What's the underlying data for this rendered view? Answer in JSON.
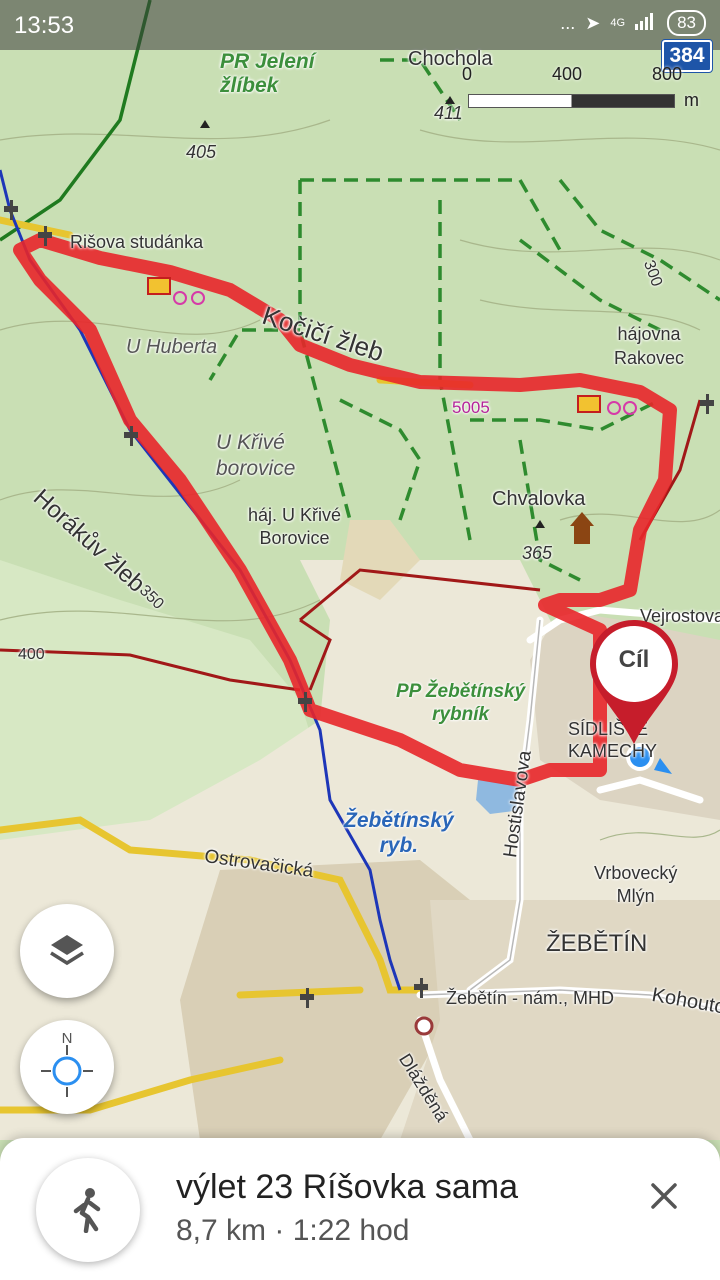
{
  "status_bar": {
    "time": "13:53",
    "dots": "...",
    "network": "4G",
    "battery": "83"
  },
  "route_number": "384",
  "scale": {
    "zero": "0",
    "mid": "400",
    "end": "800",
    "unit": "m"
  },
  "map_labels": {
    "pr_jeleni_zlibek": "PR Jelení\nžlíbek",
    "chochola": "Chochola",
    "e411": "411",
    "e405": "405",
    "risova_studanka": "Rišova studánka",
    "u_huberta": "U Huberta",
    "kocici_zleb": "Kočičí žleb",
    "hajovna_rakovec": "hájovna\nRakovec",
    "c300": "300",
    "route_5005": "5005",
    "u_krive_borovice": "U Křivé\nborovice",
    "haj_u_krive": "háj. U Křivé\nBorovice",
    "horakuv_zleb": "Horákův žleb",
    "c350": "350",
    "chvalovka": "Chvalovka",
    "e365": "365",
    "c400": "400",
    "vejrostova": "Vejrostova",
    "pp_zebetinsky_rybnik": "PP Žebětínský\nrybník",
    "sidliste_kamechy": "SÍDLIŠTĚ\nKAMECHY",
    "hostislavova": "Hostislavova",
    "zebetinsky_ryb": "Žebětínský\nryb.",
    "ostrovacicka": "Ostrovačická",
    "vrbovecky_mlyn": "Vrbovecký\nMlýn",
    "zebetin": "ŽEBĚTÍN",
    "zebetin_nam": "Žebětín - nám., MHD",
    "kohoutovicka": "Kohoutovická",
    "dlazdena": "Dlážděná"
  },
  "destination_pin": {
    "label": "Cíl"
  },
  "controls": {
    "compass_n": "N"
  },
  "trip": {
    "title": "výlet 23 Ríšovka sama",
    "summary": "8,7 km · 1:22 hod"
  },
  "colors": {
    "route": "#e8262a",
    "forest": "#c9dfb4",
    "path_green": "#2e8b2e",
    "road_yellow": "#e7c530",
    "accent_blue": "#1e55a8"
  }
}
